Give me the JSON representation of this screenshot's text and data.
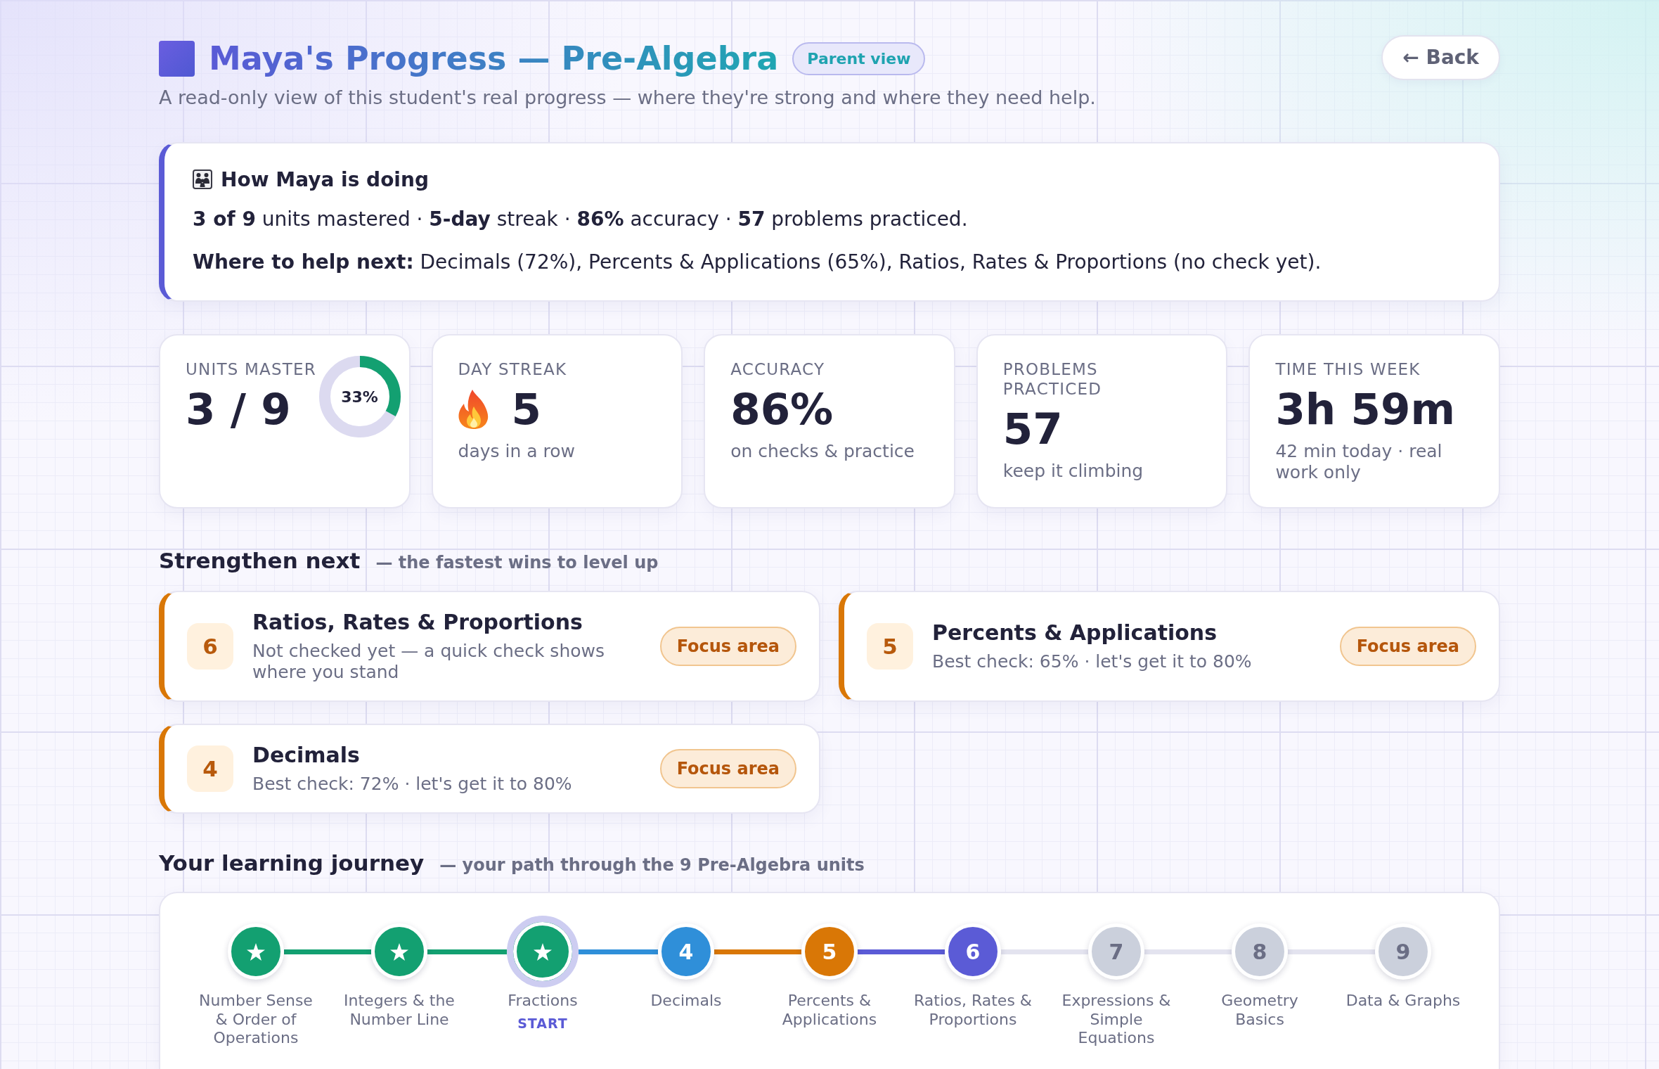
{
  "header": {
    "title": "Maya's Progress — Pre-Algebra",
    "badge": "Parent view",
    "subtitle": "A read-only view of this student's real progress — where they're strong and where they need help.",
    "back_button": "← Back"
  },
  "summary": {
    "title": "How Maya is doing",
    "lines": [
      "**3 of 9** units mastered · **5-day** streak · **86%** accuracy · **57** problems practiced.",
      "**Where to help next:** Decimals (72%), Percents & Applications (65%), Ratios, Rates & Proportions (no check yet)."
    ]
  },
  "stats": [
    {
      "kind": "ring",
      "label": "UNITS MASTER",
      "value": "3 / 9",
      "level": 0.33,
      "reading": "33%"
    },
    {
      "kind": "streak",
      "label": "DAY STREAK",
      "value": "5",
      "note": "days in a row"
    },
    {
      "kind": "plain",
      "label": "ACCURACY",
      "value": "86%",
      "note": "on checks & practice"
    },
    {
      "kind": "plain",
      "label": "PROBLEMS PRACTICED",
      "value": "57",
      "note": "keep it climbing"
    },
    {
      "kind": "plain",
      "label": "TIME THIS WEEK",
      "value": "3h 59m",
      "note": "42 min today · real work only"
    }
  ],
  "strengthen": {
    "title": "Strengthen next",
    "subtitle": "— the fastest wins to level up",
    "items": [
      {
        "number": "6",
        "title": "Ratios, Rates & Proportions",
        "note": "Not checked yet — a quick check shows where you stand",
        "badge": "Focus area"
      },
      {
        "number": "5",
        "title": "Percents & Applications",
        "note": "Best check: 65% · let's get it to 80%",
        "badge": "Focus area"
      },
      {
        "number": "4",
        "title": "Decimals",
        "note": "Best check: 72% · let's get it to 80%",
        "badge": "Focus area"
      }
    ]
  },
  "journey": {
    "title": "Your learning journey",
    "subtitle": "— your path through the 9 Pre-Algebra units",
    "units": [
      {
        "mastered": true,
        "locked": false,
        "color": "#13a071",
        "name": "Number Sense & Order of Operations",
        "start": false
      },
      {
        "mastered": true,
        "locked": false,
        "color": "#13a071",
        "name": "Integers & the Number Line",
        "start": false
      },
      {
        "mastered": true,
        "locked": false,
        "color": "#13a071",
        "name": "Fractions",
        "start": true,
        "tag": "START"
      },
      {
        "mastered": false,
        "locked": false,
        "color": "#2f8fd9",
        "number": "4",
        "name": "Decimals",
        "start": false
      },
      {
        "mastered": false,
        "locked": false,
        "color": "#d97706",
        "number": "5",
        "name": "Percents & Applications",
        "start": false
      },
      {
        "mastered": false,
        "locked": false,
        "color": "#5b5bd6",
        "number": "6",
        "name": "Ratios, Rates & Proportions",
        "start": false
      },
      {
        "mastered": false,
        "locked": true,
        "color": "#cbd0dc",
        "number": "7",
        "name": "Expressions & Simple Equations",
        "start": false
      },
      {
        "mastered": false,
        "locked": true,
        "color": "#cbd0dc",
        "number": "8",
        "name": "Geometry Basics",
        "start": false
      },
      {
        "mastered": false,
        "locked": true,
        "color": "#cbd0dc",
        "number": "9",
        "name": "Data & Graphs",
        "start": false
      }
    ]
  }
}
